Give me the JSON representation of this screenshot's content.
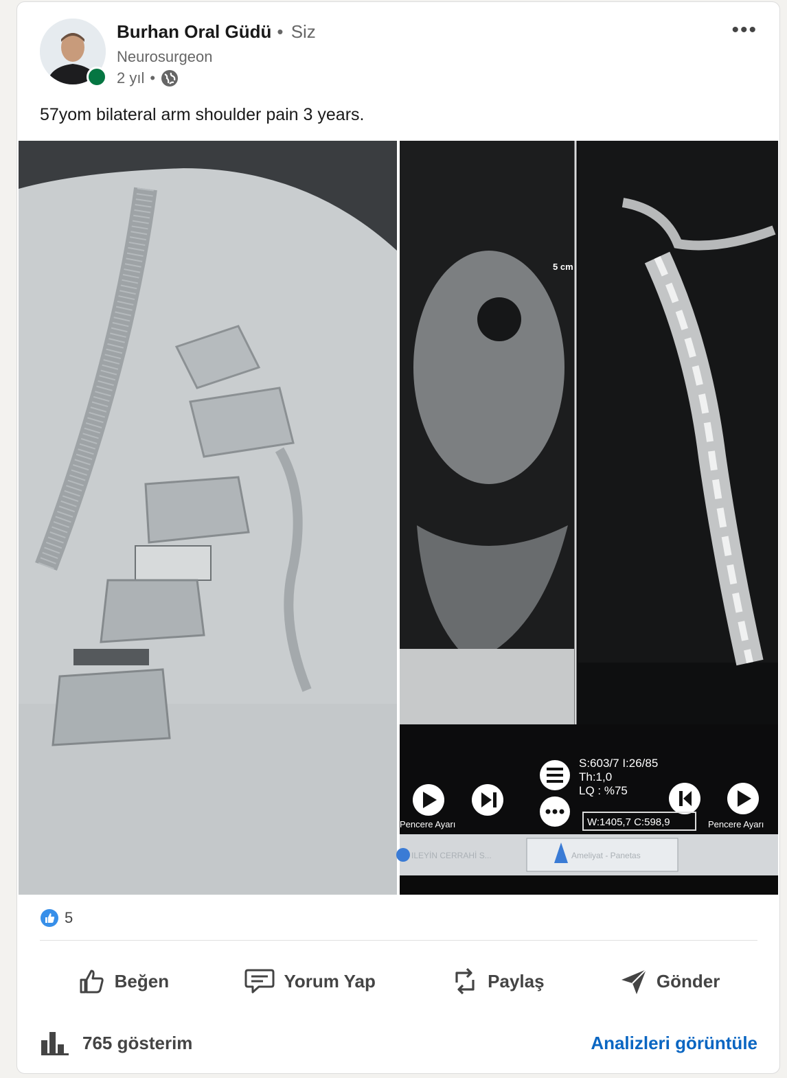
{
  "post": {
    "author_name": "Burhan Oral Güdü",
    "author_badge": "Siz",
    "headline": "Neurosurgeon",
    "time": "2 yıl",
    "text": "57yom bilateral arm shoulder pain 3 years."
  },
  "media": {
    "ct_scale_label": "5 cm",
    "ct_info_line1": "S:603/7 I:26/85",
    "ct_info_line2": "Th:1,0",
    "ct_info_line3": "LQ : %75",
    "ct_window_value": "W:1405,7 C:598,9",
    "ct_button_left": "Pencere Ayarı",
    "ct_button_right": "Pencere Ayarı",
    "ct_tab1": "ILEYİN CERRAHİ S...",
    "ct_tab2": "Ameliyat - Panetas"
  },
  "reactions": {
    "count": "5",
    "icon": "like-reaction-icon"
  },
  "actions": {
    "like": "Beğen",
    "comment": "Yorum Yap",
    "repost": "Paylaş",
    "send": "Gönder"
  },
  "footer": {
    "impressions": "765 gösterim",
    "analytics_link": "Analizleri görüntüle"
  },
  "colors": {
    "accent": "#0a66c2",
    "online": "#057642",
    "text_secondary": "#666666"
  }
}
